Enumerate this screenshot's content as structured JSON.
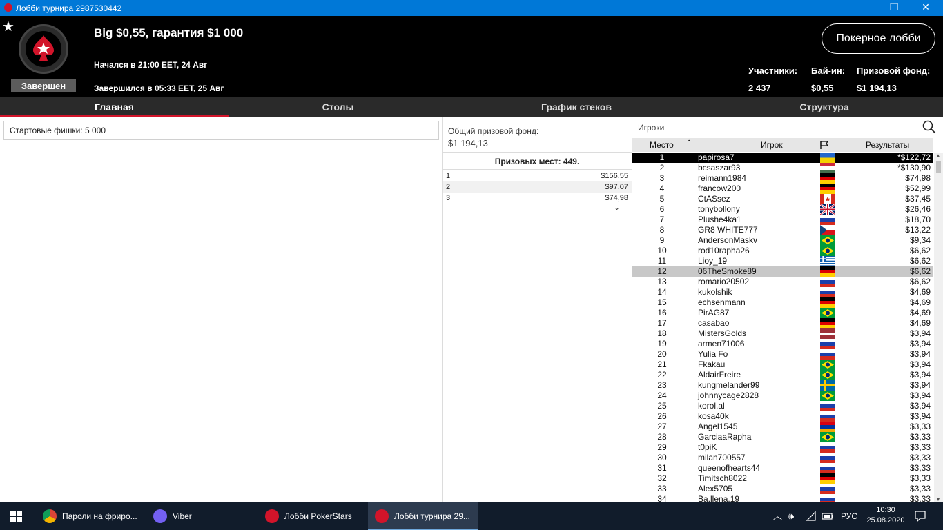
{
  "window": {
    "title": "Лобби турнира 2987530442",
    "minimize": "—",
    "maximize": "❐",
    "close": "✕"
  },
  "header": {
    "status": "Завершен",
    "name": "Big $0,55, гарантия $1 000",
    "started": "Начался в 21:00 EET, 24 Авг",
    "ended": "Завершился в 05:33 EET, 25 Авг",
    "lobby_button": "Покерное лобби",
    "entrants_label": "Участники:",
    "entrants_value": "2 437",
    "buyin_label": "Бай-ин:",
    "buyin_value": "$0,55",
    "pool_label": "Призовой фонд:",
    "pool_value": "$1 194,13"
  },
  "tabs": [
    {
      "label": "Главная"
    },
    {
      "label": "Столы"
    },
    {
      "label": "График стеков"
    },
    {
      "label": "Структура"
    }
  ],
  "main": {
    "starting_chips_label": "Стартовые фишки:",
    "starting_chips_value": "5 000"
  },
  "prizes": {
    "pool_label": "Общий призовой фонд:",
    "pool_value": "$1 194,13",
    "places_text": "Призовых мест: 449.",
    "rows": [
      {
        "place": "1",
        "value": "$156,55"
      },
      {
        "place": "2",
        "value": "$97,07"
      },
      {
        "place": "3",
        "value": "$74,98"
      }
    ]
  },
  "players": {
    "search_label": "Игроки",
    "columns": {
      "place": "Место",
      "player": "Игрок",
      "results": "Результаты"
    },
    "rows": [
      {
        "place": "1",
        "name": "papirosa7",
        "flag": "ukraine",
        "result": "*$122,72"
      },
      {
        "place": "2",
        "name": "bcsaszar93",
        "flag": "hungary",
        "result": "*$130,90"
      },
      {
        "place": "3",
        "name": "reimann1984",
        "flag": "germany",
        "result": "$74,98"
      },
      {
        "place": "4",
        "name": "francow200",
        "flag": "germany",
        "result": "$52,99"
      },
      {
        "place": "5",
        "name": "CtASsez",
        "flag": "canada",
        "result": "$37,45"
      },
      {
        "place": "6",
        "name": "tonybollony",
        "flag": "uk",
        "result": "$26,46"
      },
      {
        "place": "7",
        "name": "Plushe4ka1",
        "flag": "russia",
        "result": "$18,70"
      },
      {
        "place": "8",
        "name": "GR8 WHITE777",
        "flag": "czech",
        "result": "$13,22"
      },
      {
        "place": "9",
        "name": "AndersonMaskv",
        "flag": "brazil",
        "result": "$9,34"
      },
      {
        "place": "10",
        "name": "rod10rapha26",
        "flag": "brazil",
        "result": "$6,62"
      },
      {
        "place": "11",
        "name": "Lioy_19",
        "flag": "greece",
        "result": "$6,62"
      },
      {
        "place": "12",
        "name": "06TheSmoke89",
        "flag": "germany",
        "result": "$6,62"
      },
      {
        "place": "13",
        "name": "romario20502",
        "flag": "russia",
        "result": "$6,62"
      },
      {
        "place": "14",
        "name": "kukolshik",
        "flag": "russia",
        "result": "$4,69"
      },
      {
        "place": "15",
        "name": "echsenmann",
        "flag": "germany",
        "result": "$4,69"
      },
      {
        "place": "16",
        "name": "PirAG87",
        "flag": "brazil",
        "result": "$4,69"
      },
      {
        "place": "17",
        "name": "casabao",
        "flag": "germany",
        "result": "$4,69"
      },
      {
        "place": "18",
        "name": "MistersGolds",
        "flag": "latvia",
        "result": "$3,94"
      },
      {
        "place": "19",
        "name": "armen71006",
        "flag": "russia",
        "result": "$3,94"
      },
      {
        "place": "20",
        "name": "Yulia Fo",
        "flag": "russia",
        "result": "$3,94"
      },
      {
        "place": "21",
        "name": "Fkakau",
        "flag": "brazil",
        "result": "$3,94"
      },
      {
        "place": "22",
        "name": "AldairFreire",
        "flag": "brazil",
        "result": "$3,94"
      },
      {
        "place": "23",
        "name": "kungmelander99",
        "flag": "sweden",
        "result": "$3,94"
      },
      {
        "place": "24",
        "name": "johnnycage2828",
        "flag": "brazil",
        "result": "$3,94"
      },
      {
        "place": "25",
        "name": "korol.al",
        "flag": "russia",
        "result": "$3,94"
      },
      {
        "place": "26",
        "name": "kosa40k",
        "flag": "russia",
        "result": "$3,94"
      },
      {
        "place": "27",
        "name": "Angel1545",
        "flag": "armenia",
        "result": "$3,33"
      },
      {
        "place": "28",
        "name": "GarciaaRapha",
        "flag": "brazil",
        "result": "$3,33"
      },
      {
        "place": "29",
        "name": "t0piK",
        "flag": "russia",
        "result": "$3,33"
      },
      {
        "place": "30",
        "name": "milan700557",
        "flag": "russia",
        "result": "$3,33"
      },
      {
        "place": "31",
        "name": "queenofhearts44",
        "flag": "russia",
        "result": "$3,33"
      },
      {
        "place": "32",
        "name": "Timitsch8022",
        "flag": "germany",
        "result": "$3,33"
      },
      {
        "place": "33",
        "name": "Alex5705",
        "flag": "russia",
        "result": "$3,33"
      },
      {
        "place": "34",
        "name": "Ba.llena.19",
        "flag": "russia",
        "result": "$3,33"
      }
    ]
  },
  "taskbar": {
    "items": [
      {
        "label": "Пароли на фриро..."
      },
      {
        "label": "Viber"
      },
      {
        "label": "Лобби PokerStars"
      },
      {
        "label": "Лобби турнира 29..."
      }
    ],
    "lang": "РУС",
    "time": "10:30",
    "date": "25.08.2020"
  }
}
